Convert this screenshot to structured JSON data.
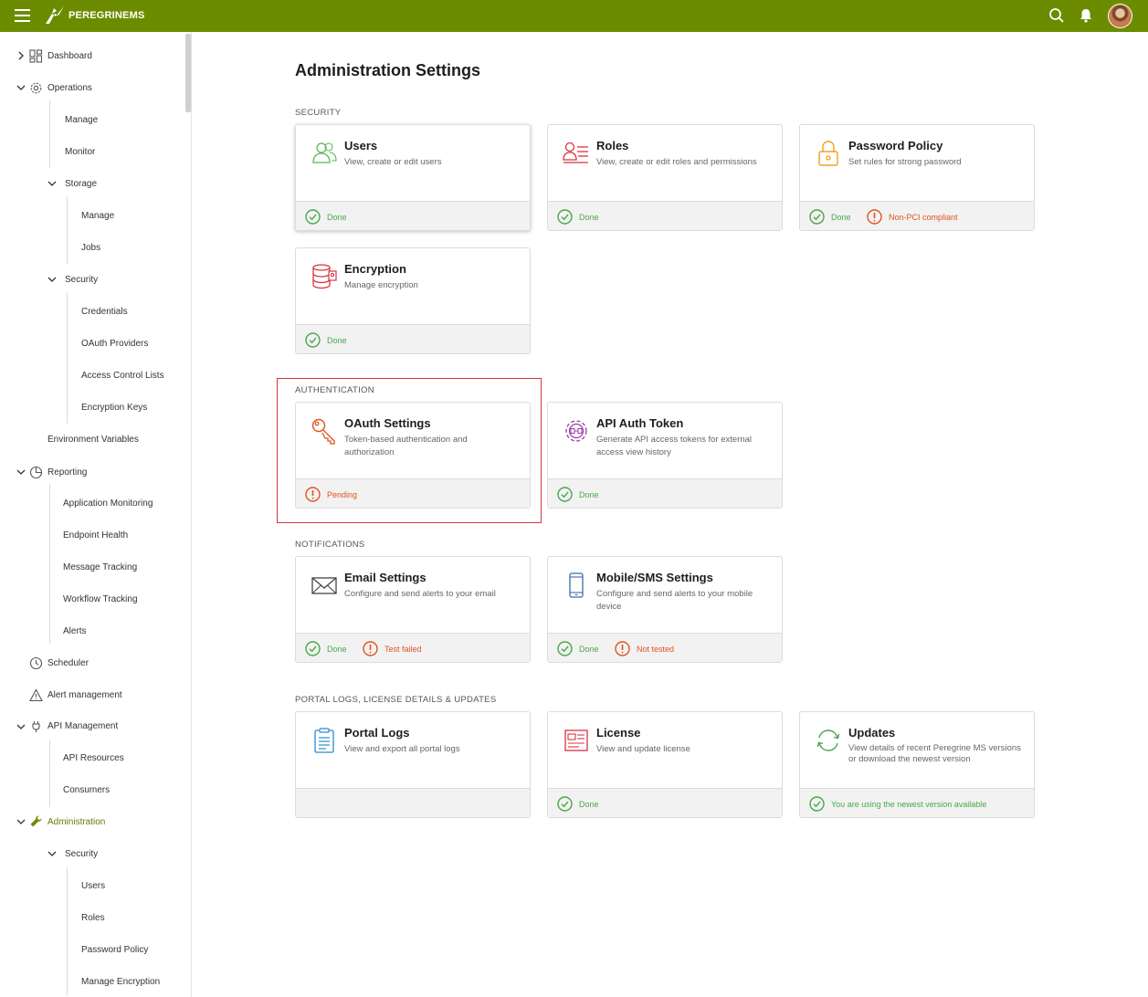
{
  "app": {
    "brand": "PEREGRINEMS",
    "brand_color": "#6c8c00"
  },
  "topbar": {
    "menu_icon": "hamburger-icon",
    "search_icon": "search-icon",
    "notifications_icon": "bell-icon",
    "avatar": "user-avatar"
  },
  "sidebar": {
    "dashboard": "Dashboard",
    "operations": "Operations",
    "ops_manage": "Manage",
    "ops_monitor": "Monitor",
    "storage": "Storage",
    "storage_manage": "Manage",
    "storage_jobs": "Jobs",
    "security": "Security",
    "credentials": "Credentials",
    "oauth_providers": "OAuth Providers",
    "acl": "Access Control Lists",
    "encryption_keys": "Encryption Keys",
    "env_vars": "Environment Variables",
    "reporting": "Reporting",
    "app_monitoring": "Application Monitoring",
    "endpoint_health": "Endpoint Health",
    "message_tracking": "Message Tracking",
    "workflow_tracking": "Workflow Tracking",
    "alerts": "Alerts",
    "scheduler": "Scheduler",
    "alert_management": "Alert management",
    "api_management": "API Management",
    "api_resources": "API Resources",
    "consumers": "Consumers",
    "administration": "Administration",
    "admin_security": "Security",
    "admin_users": "Users",
    "admin_roles": "Roles",
    "admin_password_policy": "Password Policy",
    "admin_manage_encryption": "Manage Encryption"
  },
  "main": {
    "title": "Administration Settings",
    "sections": {
      "security": "SECURITY",
      "authentication": "AUTHENTICATION",
      "notifications": "NOTIFICATIONS",
      "portal": "PORTAL LOGS, LICENSE DETAILS & UPDATES"
    },
    "cards": {
      "users": {
        "title": "Users",
        "desc": "View, create or edit users",
        "status": "Done"
      },
      "roles": {
        "title": "Roles",
        "desc": "View, create or edit roles and permissions",
        "status": "Done"
      },
      "password_policy": {
        "title": "Password Policy",
        "desc": "Set rules for strong password",
        "status": "Done",
        "warning": "Non-PCI compliant"
      },
      "encryption": {
        "title": "Encryption",
        "desc": "Manage encryption",
        "status": "Done"
      },
      "oauth": {
        "title": "OAuth Settings",
        "desc": "Token-based authentication and authorization",
        "warning": "Pending"
      },
      "api_token": {
        "title": "API Auth Token",
        "desc": "Generate API access tokens for external access view history",
        "status": "Done"
      },
      "email": {
        "title": "Email Settings",
        "desc": "Configure and send alerts to your email",
        "status": "Done",
        "warning": "Test failed"
      },
      "sms": {
        "title": "Mobile/SMS Settings",
        "desc": "Configure and send alerts to your mobile device",
        "status": "Done",
        "warning": "Not tested"
      },
      "portal_logs": {
        "title": "Portal Logs",
        "desc": "View and export all portal logs"
      },
      "license": {
        "title": "License",
        "desc": "View and update license",
        "status": "Done"
      },
      "updates": {
        "title": "Updates",
        "desc": "View details of recent Peregrine MS versions or download the newest version",
        "status": "You are using the newest version available"
      }
    }
  },
  "colors": {
    "ok": "#4ba64b",
    "warn": "#e0531e",
    "highlight": "#d9333f"
  }
}
